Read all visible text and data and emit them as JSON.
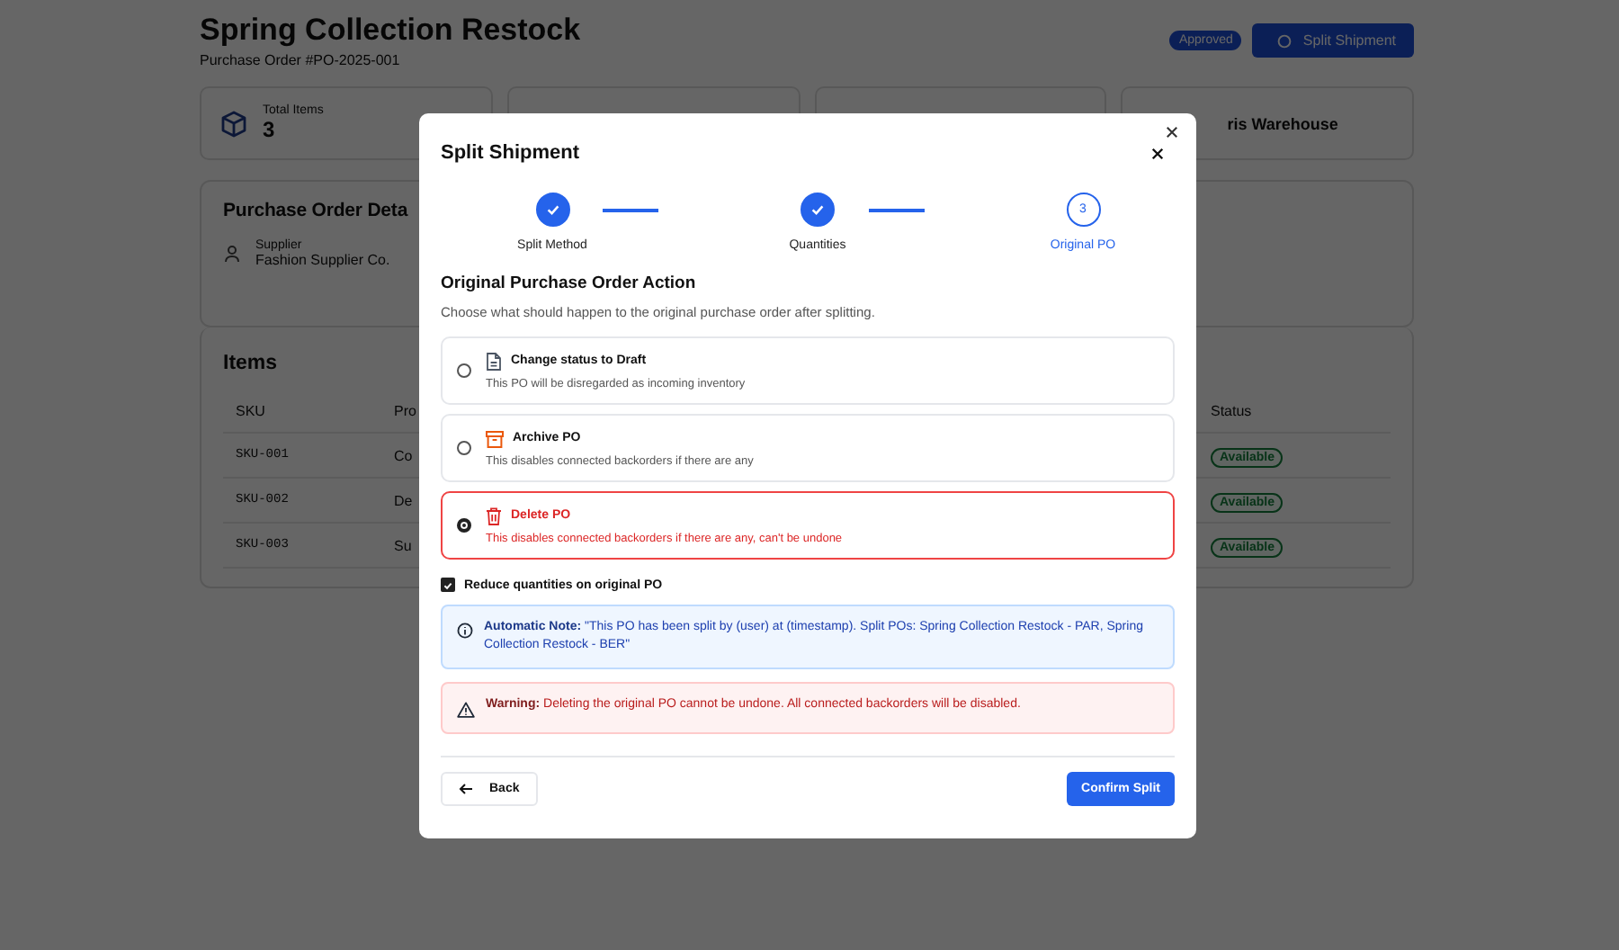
{
  "page": {
    "title": "Spring Collection Restock",
    "subtitle": "Purchase Order #PO-2025-001",
    "status_badge": "Approved",
    "action_button": "Split Shipment"
  },
  "stats": [
    {
      "kind": "icon",
      "label": "Total Items",
      "value": "3"
    },
    {
      "kind": "covered"
    },
    {
      "kind": "covered"
    },
    {
      "kind": "plain",
      "value": "ris Warehouse"
    }
  ],
  "details": {
    "title": "Purchase Order Deta",
    "supplier_label": "Supplier",
    "supplier": "Fashion Supplier Co."
  },
  "items": {
    "title": "Items",
    "columns": [
      "SKU",
      "Pro",
      "Status"
    ],
    "rows": [
      {
        "sku": "SKU-001",
        "product": "Co",
        "status": "Available"
      },
      {
        "sku": "SKU-002",
        "product": "De",
        "status": "Available"
      },
      {
        "sku": "SKU-003",
        "product": "Su",
        "status": "Available"
      }
    ]
  },
  "dialog": {
    "title": "Split Shipment",
    "steps": [
      {
        "label": "Split Method",
        "done": true,
        "selected": false
      },
      {
        "label": "Quantities",
        "done": true,
        "selected": false
      },
      {
        "label": "Original PO",
        "number": "3",
        "done": false,
        "selected": true
      }
    ],
    "section_title": "Original Purchase Order Action",
    "section_description": "Choose what should happen to the original purchase order after splitting.",
    "options": [
      {
        "kind": "draft",
        "title": "Change status to Draft",
        "description": "This PO will be disregarded as incoming inventory",
        "selected": false
      },
      {
        "kind": "archive",
        "title": "Archive PO",
        "description": "This disables connected backorders if there are any",
        "selected": false
      },
      {
        "kind": "delete",
        "title": "Delete PO",
        "description": "This disables connected backorders if there are any, can't be undone",
        "selected": true
      }
    ],
    "reduce_checkbox": {
      "label": "Reduce quantities on original PO",
      "checked": true
    },
    "note": "**Automatic Note:** \"This PO has been split by (user) at (timestamp). Split POs: Spring Collection Restock - PAR, Spring Collection Restock - BER\"",
    "warning": "**Warning:** Deleting the original PO cannot be undone. All connected backorders will be disabled.",
    "back_button": "Back",
    "confirm_button": "Confirm Split"
  }
}
